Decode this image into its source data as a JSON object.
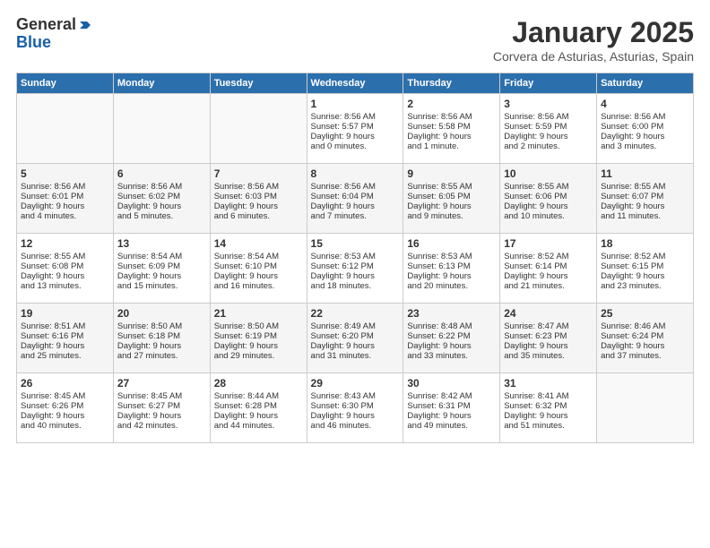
{
  "header": {
    "logo_line1": "General",
    "logo_line2": "Blue",
    "month": "January 2025",
    "location": "Corvera de Asturias, Asturias, Spain"
  },
  "days_of_week": [
    "Sunday",
    "Monday",
    "Tuesday",
    "Wednesday",
    "Thursday",
    "Friday",
    "Saturday"
  ],
  "weeks": [
    [
      {
        "day": "",
        "info": ""
      },
      {
        "day": "",
        "info": ""
      },
      {
        "day": "",
        "info": ""
      },
      {
        "day": "1",
        "info": "Sunrise: 8:56 AM\nSunset: 5:57 PM\nDaylight: 9 hours\nand 0 minutes."
      },
      {
        "day": "2",
        "info": "Sunrise: 8:56 AM\nSunset: 5:58 PM\nDaylight: 9 hours\nand 1 minute."
      },
      {
        "day": "3",
        "info": "Sunrise: 8:56 AM\nSunset: 5:59 PM\nDaylight: 9 hours\nand 2 minutes."
      },
      {
        "day": "4",
        "info": "Sunrise: 8:56 AM\nSunset: 6:00 PM\nDaylight: 9 hours\nand 3 minutes."
      }
    ],
    [
      {
        "day": "5",
        "info": "Sunrise: 8:56 AM\nSunset: 6:01 PM\nDaylight: 9 hours\nand 4 minutes."
      },
      {
        "day": "6",
        "info": "Sunrise: 8:56 AM\nSunset: 6:02 PM\nDaylight: 9 hours\nand 5 minutes."
      },
      {
        "day": "7",
        "info": "Sunrise: 8:56 AM\nSunset: 6:03 PM\nDaylight: 9 hours\nand 6 minutes."
      },
      {
        "day": "8",
        "info": "Sunrise: 8:56 AM\nSunset: 6:04 PM\nDaylight: 9 hours\nand 7 minutes."
      },
      {
        "day": "9",
        "info": "Sunrise: 8:55 AM\nSunset: 6:05 PM\nDaylight: 9 hours\nand 9 minutes."
      },
      {
        "day": "10",
        "info": "Sunrise: 8:55 AM\nSunset: 6:06 PM\nDaylight: 9 hours\nand 10 minutes."
      },
      {
        "day": "11",
        "info": "Sunrise: 8:55 AM\nSunset: 6:07 PM\nDaylight: 9 hours\nand 11 minutes."
      }
    ],
    [
      {
        "day": "12",
        "info": "Sunrise: 8:55 AM\nSunset: 6:08 PM\nDaylight: 9 hours\nand 13 minutes."
      },
      {
        "day": "13",
        "info": "Sunrise: 8:54 AM\nSunset: 6:09 PM\nDaylight: 9 hours\nand 15 minutes."
      },
      {
        "day": "14",
        "info": "Sunrise: 8:54 AM\nSunset: 6:10 PM\nDaylight: 9 hours\nand 16 minutes."
      },
      {
        "day": "15",
        "info": "Sunrise: 8:53 AM\nSunset: 6:12 PM\nDaylight: 9 hours\nand 18 minutes."
      },
      {
        "day": "16",
        "info": "Sunrise: 8:53 AM\nSunset: 6:13 PM\nDaylight: 9 hours\nand 20 minutes."
      },
      {
        "day": "17",
        "info": "Sunrise: 8:52 AM\nSunset: 6:14 PM\nDaylight: 9 hours\nand 21 minutes."
      },
      {
        "day": "18",
        "info": "Sunrise: 8:52 AM\nSunset: 6:15 PM\nDaylight: 9 hours\nand 23 minutes."
      }
    ],
    [
      {
        "day": "19",
        "info": "Sunrise: 8:51 AM\nSunset: 6:16 PM\nDaylight: 9 hours\nand 25 minutes."
      },
      {
        "day": "20",
        "info": "Sunrise: 8:50 AM\nSunset: 6:18 PM\nDaylight: 9 hours\nand 27 minutes."
      },
      {
        "day": "21",
        "info": "Sunrise: 8:50 AM\nSunset: 6:19 PM\nDaylight: 9 hours\nand 29 minutes."
      },
      {
        "day": "22",
        "info": "Sunrise: 8:49 AM\nSunset: 6:20 PM\nDaylight: 9 hours\nand 31 minutes."
      },
      {
        "day": "23",
        "info": "Sunrise: 8:48 AM\nSunset: 6:22 PM\nDaylight: 9 hours\nand 33 minutes."
      },
      {
        "day": "24",
        "info": "Sunrise: 8:47 AM\nSunset: 6:23 PM\nDaylight: 9 hours\nand 35 minutes."
      },
      {
        "day": "25",
        "info": "Sunrise: 8:46 AM\nSunset: 6:24 PM\nDaylight: 9 hours\nand 37 minutes."
      }
    ],
    [
      {
        "day": "26",
        "info": "Sunrise: 8:45 AM\nSunset: 6:26 PM\nDaylight: 9 hours\nand 40 minutes."
      },
      {
        "day": "27",
        "info": "Sunrise: 8:45 AM\nSunset: 6:27 PM\nDaylight: 9 hours\nand 42 minutes."
      },
      {
        "day": "28",
        "info": "Sunrise: 8:44 AM\nSunset: 6:28 PM\nDaylight: 9 hours\nand 44 minutes."
      },
      {
        "day": "29",
        "info": "Sunrise: 8:43 AM\nSunset: 6:30 PM\nDaylight: 9 hours\nand 46 minutes."
      },
      {
        "day": "30",
        "info": "Sunrise: 8:42 AM\nSunset: 6:31 PM\nDaylight: 9 hours\nand 49 minutes."
      },
      {
        "day": "31",
        "info": "Sunrise: 8:41 AM\nSunset: 6:32 PM\nDaylight: 9 hours\nand 51 minutes."
      },
      {
        "day": "",
        "info": ""
      }
    ]
  ]
}
